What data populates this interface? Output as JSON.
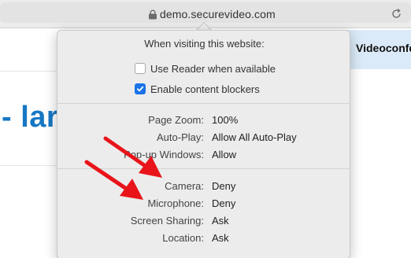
{
  "browser": {
    "url": "demo.securevideo.com"
  },
  "page": {
    "heading": "- lar",
    "banner_text": "Videoconfe"
  },
  "popover": {
    "title": "When visiting this website:",
    "checkboxes": [
      {
        "label": "Use Reader when available",
        "checked": false
      },
      {
        "label": "Enable content blockers",
        "checked": true
      }
    ],
    "settings_group_1": [
      {
        "label": "Page Zoom:",
        "value": "100%"
      },
      {
        "label": "Auto-Play:",
        "value": "Allow All Auto-Play"
      },
      {
        "label": "Pop-up Windows:",
        "value": "Allow"
      }
    ],
    "settings_group_2": [
      {
        "label": "Camera:",
        "value": "Deny"
      },
      {
        "label": "Microphone:",
        "value": "Deny"
      },
      {
        "label": "Screen Sharing:",
        "value": "Ask"
      },
      {
        "label": "Location:",
        "value": "Ask"
      }
    ]
  },
  "colors": {
    "annotation_arrow": "#e8141a",
    "checkbox_accent": "#1a73e8",
    "heading_blue": "#1677c4"
  },
  "icons": [
    "lock-icon",
    "reload-icon",
    "checkmark-icon",
    "annotation-arrow"
  ]
}
